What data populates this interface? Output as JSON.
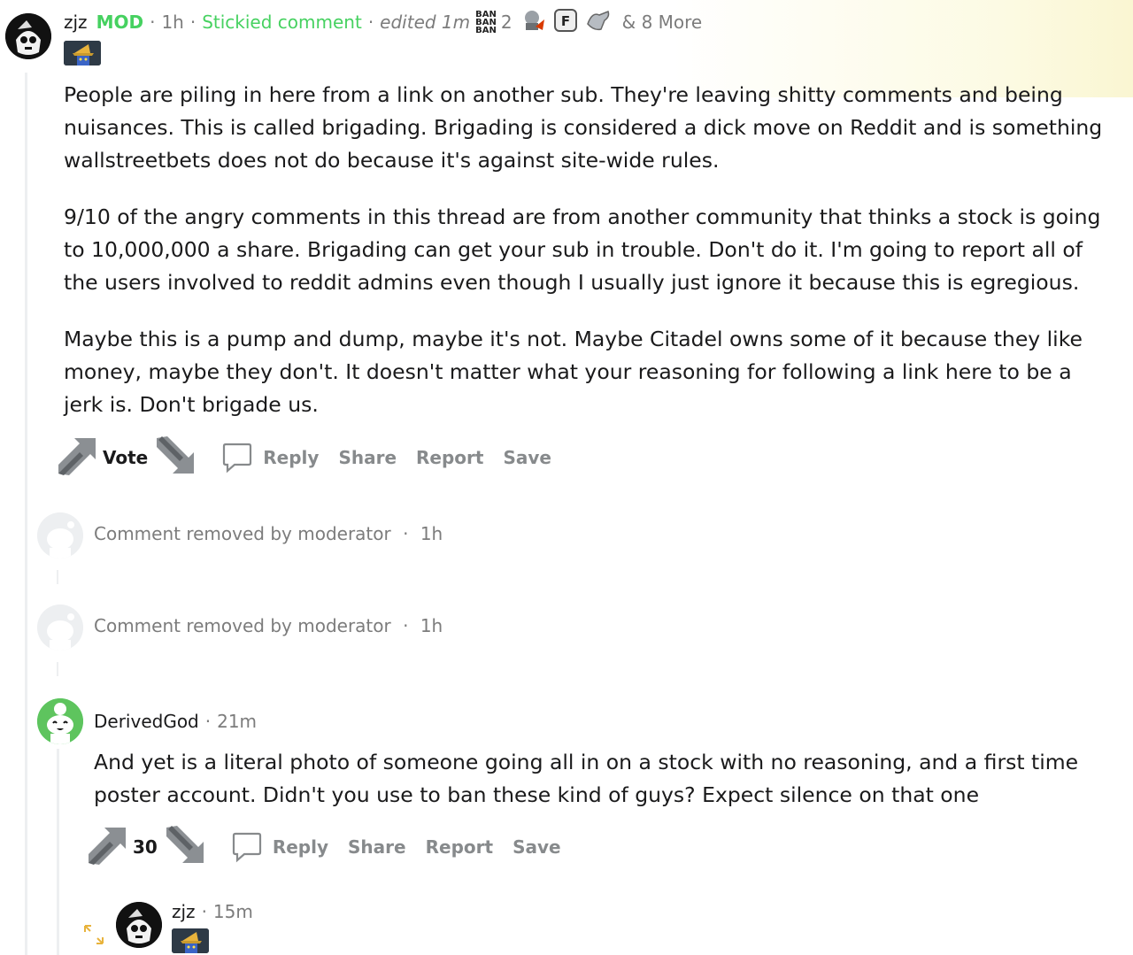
{
  "comment_main": {
    "author": "zjz",
    "mod_badge": "MOD",
    "age": "1h",
    "stickied": "Stickied comment",
    "edited": "edited 1m",
    "award_ban_text": [
      "BAN",
      "BAN",
      "BAN"
    ],
    "award_count": "2",
    "more_awards": "& 8 More",
    "paragraphs": [
      "People are piling in here from a link on another sub. They're leaving shitty comments and being nuisances. This is called brigading. Brigading is considered a dick move on Reddit and is something wallstreetbets does not do because it's against site-wide rules.",
      "9/10 of the angry comments in this thread are from another community that thinks a stock is going to 10,000,000 a share. Brigading can get your sub in trouble. Don't do it. I'm going to report all of the users involved to reddit admins even though I usually just ignore it because this is egregious.",
      "Maybe this is a pump and dump, maybe it's not. Maybe Citadel owns some of it because they like money, maybe they don't. It doesn't matter what your reasoning for following a link here to be a jerk is. Don't brigade us."
    ],
    "vote_label": "Vote",
    "actions": {
      "reply": "Reply",
      "share": "Share",
      "report": "Report",
      "save": "Save"
    }
  },
  "removed_1": {
    "text": "Comment removed by moderator",
    "sep": "·",
    "age": "1h"
  },
  "removed_2": {
    "text": "Comment removed by moderator",
    "sep": "·",
    "age": "1h"
  },
  "comment_reply": {
    "author": "DerivedGod",
    "sep": "·",
    "age": "21m",
    "paragraph": "And yet is a literal photo of someone going all in on a stock with no reasoning, and a first time poster account. Didn't you use to ban these kind of guys? Expect silence on that one",
    "votes": "30",
    "actions": {
      "reply": "Reply",
      "share": "Share",
      "report": "Report",
      "save": "Save"
    }
  },
  "comment_nested": {
    "author": "zjz",
    "sep": "·",
    "age": "15m"
  },
  "colors": {
    "mod_green": "#46d160",
    "meta_gray": "#7c7c7c",
    "action_gray": "#878a8c",
    "thread_line": "#edeff1"
  }
}
